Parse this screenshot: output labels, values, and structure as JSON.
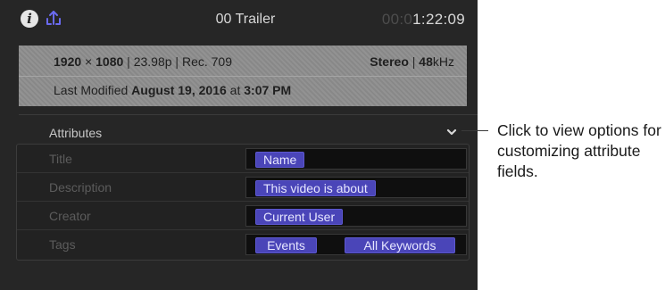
{
  "topbar": {
    "title": "00 Trailer",
    "timecode_dim": "00:0",
    "timecode_bright": "1:22:09"
  },
  "info": {
    "resolution": "1920",
    "times": "×",
    "resolution_h": "1080",
    "framerate": "23.98p",
    "colorspace": "Rec. 709",
    "audio_channels": "Stereo",
    "sample_rate_num": "48",
    "sample_rate_unit": "kHz",
    "modified_prefix": "Last Modified",
    "modified_date": "August 19, 2016",
    "modified_at": "at",
    "modified_time": "3:07 PM"
  },
  "attributes": {
    "header": "Attributes",
    "rows": [
      {
        "label": "Title",
        "tokens": [
          "Name"
        ]
      },
      {
        "label": "Description",
        "tokens": [
          "This video is about"
        ]
      },
      {
        "label": "Creator",
        "tokens": [
          "Current User"
        ]
      },
      {
        "label": "Tags",
        "tokens": [
          "Events",
          "All Keywords"
        ]
      }
    ]
  },
  "callout": {
    "text": "Click to view options for customizing attribute fields."
  },
  "colors": {
    "panel_bg": "#262626",
    "token_bg": "#4a45b8",
    "share_icon": "#6a6af0"
  }
}
